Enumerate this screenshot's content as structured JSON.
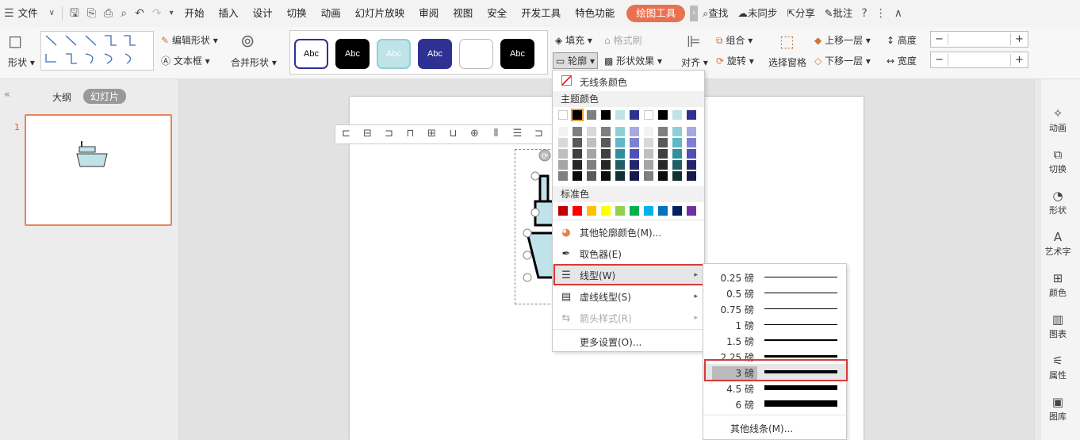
{
  "menubar": {
    "file": "文件",
    "tabs": [
      "开始",
      "插入",
      "设计",
      "切换",
      "动画",
      "幻灯片放映",
      "审阅",
      "视图",
      "安全",
      "开发工具",
      "特色功能"
    ],
    "active_tab": "绘图工具",
    "search": "查找",
    "sync": "未同步",
    "share": "分享",
    "comment": "批注"
  },
  "ribbon": {
    "shape": "形状",
    "edit_shape": "编辑形状",
    "textbox": "文本框",
    "merge_shape": "合并形状",
    "style_text": "Abc",
    "fill": "填充",
    "format_brush": "格式刷",
    "outline": "轮廓",
    "shape_effect": "形状效果",
    "align": "对齐",
    "group": "组合",
    "rotate": "旋转",
    "selection_pane": "选择窗格",
    "bring_forward": "上移一层",
    "send_backward": "下移一层",
    "height": "高度",
    "width": "宽度"
  },
  "left_panel": {
    "outline_tab": "大纲",
    "slides_tab": "幻灯片",
    "slide_number": "1"
  },
  "right_bar": [
    "动画",
    "切换",
    "形状",
    "艺术字",
    "颜色",
    "图表",
    "属性",
    "图库"
  ],
  "dropdown": {
    "no_line_color": "无线条颜色",
    "theme_colors": "主题颜色",
    "standard_colors": "标准色",
    "more_colors": "其他轮廓颜色(M)...",
    "eyedropper": "取色器(E)",
    "line_type": "线型(W)",
    "dash_type": "虚线线型(S)",
    "arrow_style": "箭头样式(R)",
    "more_settings": "更多设置(O)..."
  },
  "theme_colors_top": [
    "#ffffff",
    "#000000",
    "#7f7f7f",
    "#000000",
    "#bfe3e8",
    "#2e3192",
    "#ffffff",
    "#000000",
    "#bfe3e8",
    "#2e3192"
  ],
  "theme_shades": [
    [
      "#f2f2f2",
      "#7f7f7f",
      "#d8d8d8",
      "#7f7f7f",
      "#8fd0d8",
      "#a7a9e0",
      "#f2f2f2",
      "#7f7f7f",
      "#8fd0d8",
      "#a7a9e0"
    ],
    [
      "#d8d8d8",
      "#595959",
      "#bfbfbf",
      "#595959",
      "#5fb8c4",
      "#7d80d4",
      "#d8d8d8",
      "#595959",
      "#5fb8c4",
      "#7d80d4"
    ],
    [
      "#bfbfbf",
      "#3f3f3f",
      "#a5a5a5",
      "#3f3f3f",
      "#2f8f9c",
      "#4d51b8",
      "#bfbfbf",
      "#3f3f3f",
      "#2f8f9c",
      "#4d51b8"
    ],
    [
      "#a5a5a5",
      "#262626",
      "#7f7f7f",
      "#262626",
      "#1f5f68",
      "#23266d",
      "#a5a5a5",
      "#262626",
      "#1f5f68",
      "#23266d"
    ],
    [
      "#7f7f7f",
      "#0c0c0c",
      "#595959",
      "#0c0c0c",
      "#103035",
      "#171948",
      "#7f7f7f",
      "#0c0c0c",
      "#103035",
      "#171948"
    ]
  ],
  "standard_colors": [
    "#c00000",
    "#ff0000",
    "#ffc000",
    "#ffff00",
    "#92d050",
    "#00b050",
    "#00b0f0",
    "#0070c0",
    "#002060",
    "#7030a0"
  ],
  "line_weights": [
    {
      "label": "0.25 磅",
      "weight": 0.25
    },
    {
      "label": "0.5 磅",
      "weight": 0.5
    },
    {
      "label": "0.75 磅",
      "weight": 0.75
    },
    {
      "label": "1 磅",
      "weight": 1
    },
    {
      "label": "1.5 磅",
      "weight": 1.5
    },
    {
      "label": "2.25 磅",
      "weight": 2.25
    },
    {
      "label": "3 磅",
      "weight": 3,
      "selected": true
    },
    {
      "label": "4.5 磅",
      "weight": 4.5
    },
    {
      "label": "6 磅",
      "weight": 6
    }
  ],
  "submenu": {
    "more_lines": "其他线条(M)..."
  }
}
